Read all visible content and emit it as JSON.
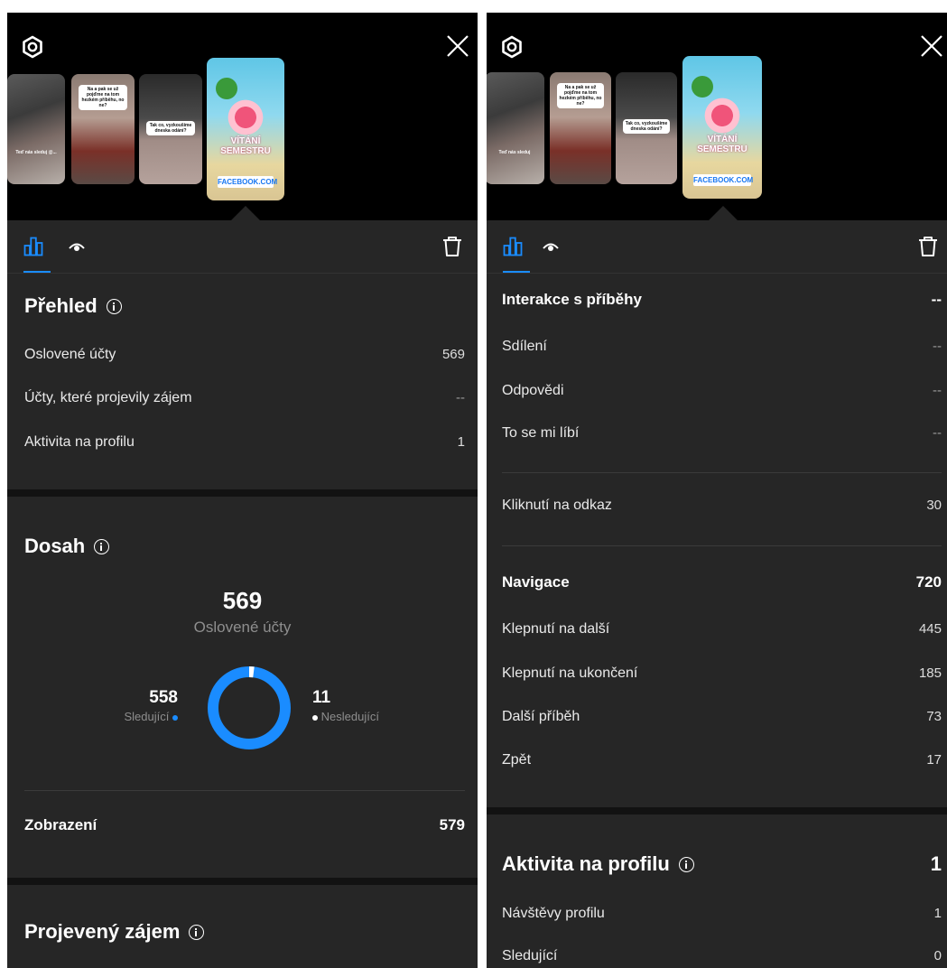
{
  "colors": {
    "accent": "#1a8cff",
    "panel": "#262626",
    "header": "#000000"
  },
  "left": {
    "thumbs": [
      {
        "caption": "Teď nás sleduj @..."
      },
      {
        "caption": "Na a pak se už pojďme na tom hezkém příběhu, no ne?"
      },
      {
        "caption": "Tak co, vyzkoušíme dneska odání?"
      },
      {
        "title": "VÍTÁNÍ SEMESTRU",
        "link": "FACEBOOK.COM"
      }
    ],
    "overview": {
      "title": "Přehled",
      "rows": [
        {
          "label": "Oslovené účty",
          "value": "569"
        },
        {
          "label": "Účty, které projevily zájem",
          "value": "--"
        },
        {
          "label": "Aktivita na profilu",
          "value": "1"
        }
      ]
    },
    "reach": {
      "title": "Dosah",
      "total": "569",
      "total_label": "Oslovené účty",
      "followers": "558",
      "followers_label": "Sledující",
      "nonfollowers": "11",
      "nonfollowers_label": "Nesledující",
      "followers_share": 0.98
    },
    "impressions": {
      "label": "Zobrazení",
      "value": "579"
    },
    "interest": {
      "title": "Projevený zájem"
    }
  },
  "right": {
    "thumbs": [
      {
        "caption": "Teď nás sleduj"
      },
      {
        "caption": "Na a pak se už pojďme na tom hezkém příběhu, no ne?"
      },
      {
        "caption": "Tak co, vyzkoušíme dneska odání?"
      },
      {
        "title": "VÍTÁNÍ SEMESTRU",
        "link": "FACEBOOK.COM"
      }
    ],
    "interactions": {
      "label": "Interakce s příběhy",
      "value": "--",
      "rows": [
        {
          "label": "Sdílení",
          "value": "--"
        },
        {
          "label": "Odpovědi",
          "value": "--"
        },
        {
          "label": "To se mi líbí",
          "value": "--"
        }
      ]
    },
    "link_clicks": {
      "label": "Kliknutí na odkaz",
      "value": "30"
    },
    "navigation": {
      "label": "Navigace",
      "value": "720",
      "rows": [
        {
          "label": "Klepnutí na další",
          "value": "445"
        },
        {
          "label": "Klepnutí na ukončení",
          "value": "185"
        },
        {
          "label": "Další příběh",
          "value": "73"
        },
        {
          "label": "Zpět",
          "value": "17"
        }
      ]
    },
    "profile_activity": {
      "title": "Aktivita na profilu",
      "value": "1",
      "rows": [
        {
          "label": "Návštěvy profilu",
          "value": "1"
        },
        {
          "label": "Sledující",
          "value": "0"
        }
      ]
    }
  }
}
